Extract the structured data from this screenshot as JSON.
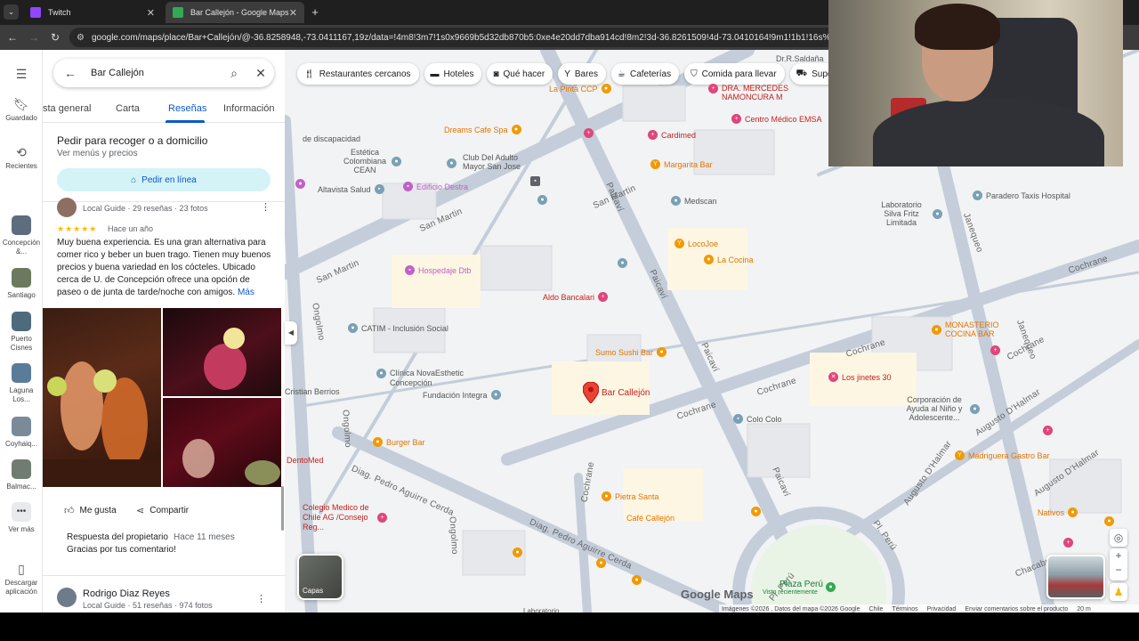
{
  "browser": {
    "tabs": [
      {
        "title": "Twitch",
        "color": "#9146ff"
      },
      {
        "title": "Bar Callejón - Google Maps",
        "color": "#34a853"
      }
    ],
    "url": "google.com/maps/place/Bar+Callejón/@-36.8258948,-73.0411167,19z/data=!4m8!3m7!1s0x9669b5d32db870b5:0xe4e20dd7dba914cd!8m2!3d-36.8261509!4d-73.0410164!9m1!1b1!16s%2Fg%2F11cn"
  },
  "rail": {
    "items": [
      {
        "label": "Guardado",
        "icon": "bookmark-icon"
      },
      {
        "label": "Recientes",
        "icon": "history-icon"
      },
      {
        "label": "Concepción &...",
        "badge": "18"
      },
      {
        "label": "Santiago",
        "badge": "3"
      },
      {
        "label": "Puerto Cisnes"
      },
      {
        "label": "Laguna Los..."
      },
      {
        "label": "Coyhaiq..."
      },
      {
        "label": "Balmac..."
      },
      {
        "label": "Ver más"
      },
      {
        "label": "Descargar aplicación"
      }
    ]
  },
  "panel": {
    "search_value": "Bar Callejón",
    "tabs": [
      "sta general",
      "Carta",
      "Reseñas",
      "Información"
    ],
    "active_tab": "Reseñas",
    "order_title": "Pedir para recoger o a domicilio",
    "order_subtitle": "Ver menús y precios",
    "order_button": "Pedir en línea",
    "review1": {
      "meta": "Local Guide · 29 reseñas · 23 fotos",
      "stars": "★★★★★",
      "date": "Hace un año",
      "text": "Muy buena experiencia. Es una gran alternativa para comer rico y beber un buen trago. Tienen muy buenos precios y buena variedad en los cócteles. Ubicado cerca de U. de Concepción ofrece una opción de paseo o de junta de tarde/noche con amigos.",
      "more": "Más",
      "like": "Me gusta",
      "share": "Compartir",
      "owner_label": "Respuesta del propietario",
      "owner_date": "Hace 11 meses",
      "owner_text": "Gracias por tus comentario!"
    },
    "review2": {
      "name": "Rodrigo Diaz Reyes",
      "meta": "Local Guide · 51 reseñas · 974 fotos"
    }
  },
  "map": {
    "chips": [
      {
        "label": "Restaurantes cercanos",
        "icon": "fork-knife-icon"
      },
      {
        "label": "Hoteles",
        "icon": "bed-icon"
      },
      {
        "label": "Qué hacer",
        "icon": "camera-icon"
      },
      {
        "label": "Bares",
        "icon": "cocktail-icon"
      },
      {
        "label": "Cafeterías",
        "icon": "coffee-icon"
      },
      {
        "label": "Comida para llevar",
        "icon": "takeout-icon"
      },
      {
        "label": "Supermerc",
        "icon": "cart-icon"
      }
    ],
    "selected_place": "Bar Callejón",
    "streets": [
      "San Martin",
      "San Martin",
      "San Martin",
      "Paicaví",
      "Paicaví",
      "Paicaví",
      "Paicaví",
      "Ongolmo",
      "Ongolmo",
      "Ongolmo",
      "Cochrane",
      "Cochrane",
      "Cochrane",
      "Cochrane",
      "Cochrane",
      "Cochrane",
      "Janequeo",
      "Janequeo",
      "Diag. Pedro Aguirre Cerda",
      "Diag. Pedro Aguirre Cerda",
      "Augusto D'Halmar",
      "Augusto D'Halmar",
      "Augusto D'Halmar",
      "Pl. Perú",
      "Pl. Perú",
      "Chacabu"
    ],
    "places": {
      "la_pinta": "La Pinta CCP",
      "saldana": "Dr.R.Saldaña",
      "mercedes": "DRA. MERCEDES NAMONCURA M",
      "emsa": "Centro Médico EMSA",
      "dreams": "Dreams Cafe Spa",
      "cardimed": "Cardimed",
      "discapacidad": "de discapacidad",
      "club": "Club Del Adulto Mayor San Jose",
      "cean": "Estética Colombiana CEAN",
      "margarita": "Margarita Bar",
      "altavista": "Altavista Salud",
      "destra": "Edificio Destra",
      "medscan": "Medscan",
      "paradero": "Paradero Taxis Hospital",
      "silva": "Laboratorio Silva Fritz Limitada",
      "locojoe": "LocoJoe",
      "cocina": "La Cocina",
      "hospedaje": "Hospedaje Dtb",
      "bancalari": "Aldo Bancalari",
      "catim": "CATIM - Inclusión Social",
      "monasterio": "MONASTERIO COCINA BAR",
      "sumo": "Sumo Sushi Bar",
      "novaesthetic": "Clínica NovaEsthetic Concepción",
      "integra": "Fundación Integra",
      "berrios": "Cristian Berrios",
      "jinetes": "Los jinetes 30",
      "corporacion": "Corporación de Ayuda al Niño y Adolescente...",
      "colo": "Colo Colo",
      "burger": "Burger Bar",
      "madriguera": "Madriguera Gastro Bar",
      "dentomed": "DentoMed",
      "pietra": "Pietra Santa",
      "cafe": "Café Callejón",
      "nativos": "Nativos",
      "colegio": "Colegio Medico de Chile AG /Consejo Reg...",
      "plaza": "Plaza Perú",
      "visto": "Visto recientemente",
      "laboratorio": "Laboratorio"
    },
    "layers_label": "Capas",
    "logo": "Google Maps",
    "attribution": [
      "Imágenes ©2026 , Datos del mapa ©2026 Google",
      "Chile",
      "Términos",
      "Privacidad",
      "Enviar comentarios sobre el producto",
      "20 m"
    ]
  },
  "colors": {
    "accent": "#0b57d0",
    "food": "#f29900",
    "health": "#e0457b",
    "pin": "#ea4335",
    "road": "#c4cdd9"
  }
}
